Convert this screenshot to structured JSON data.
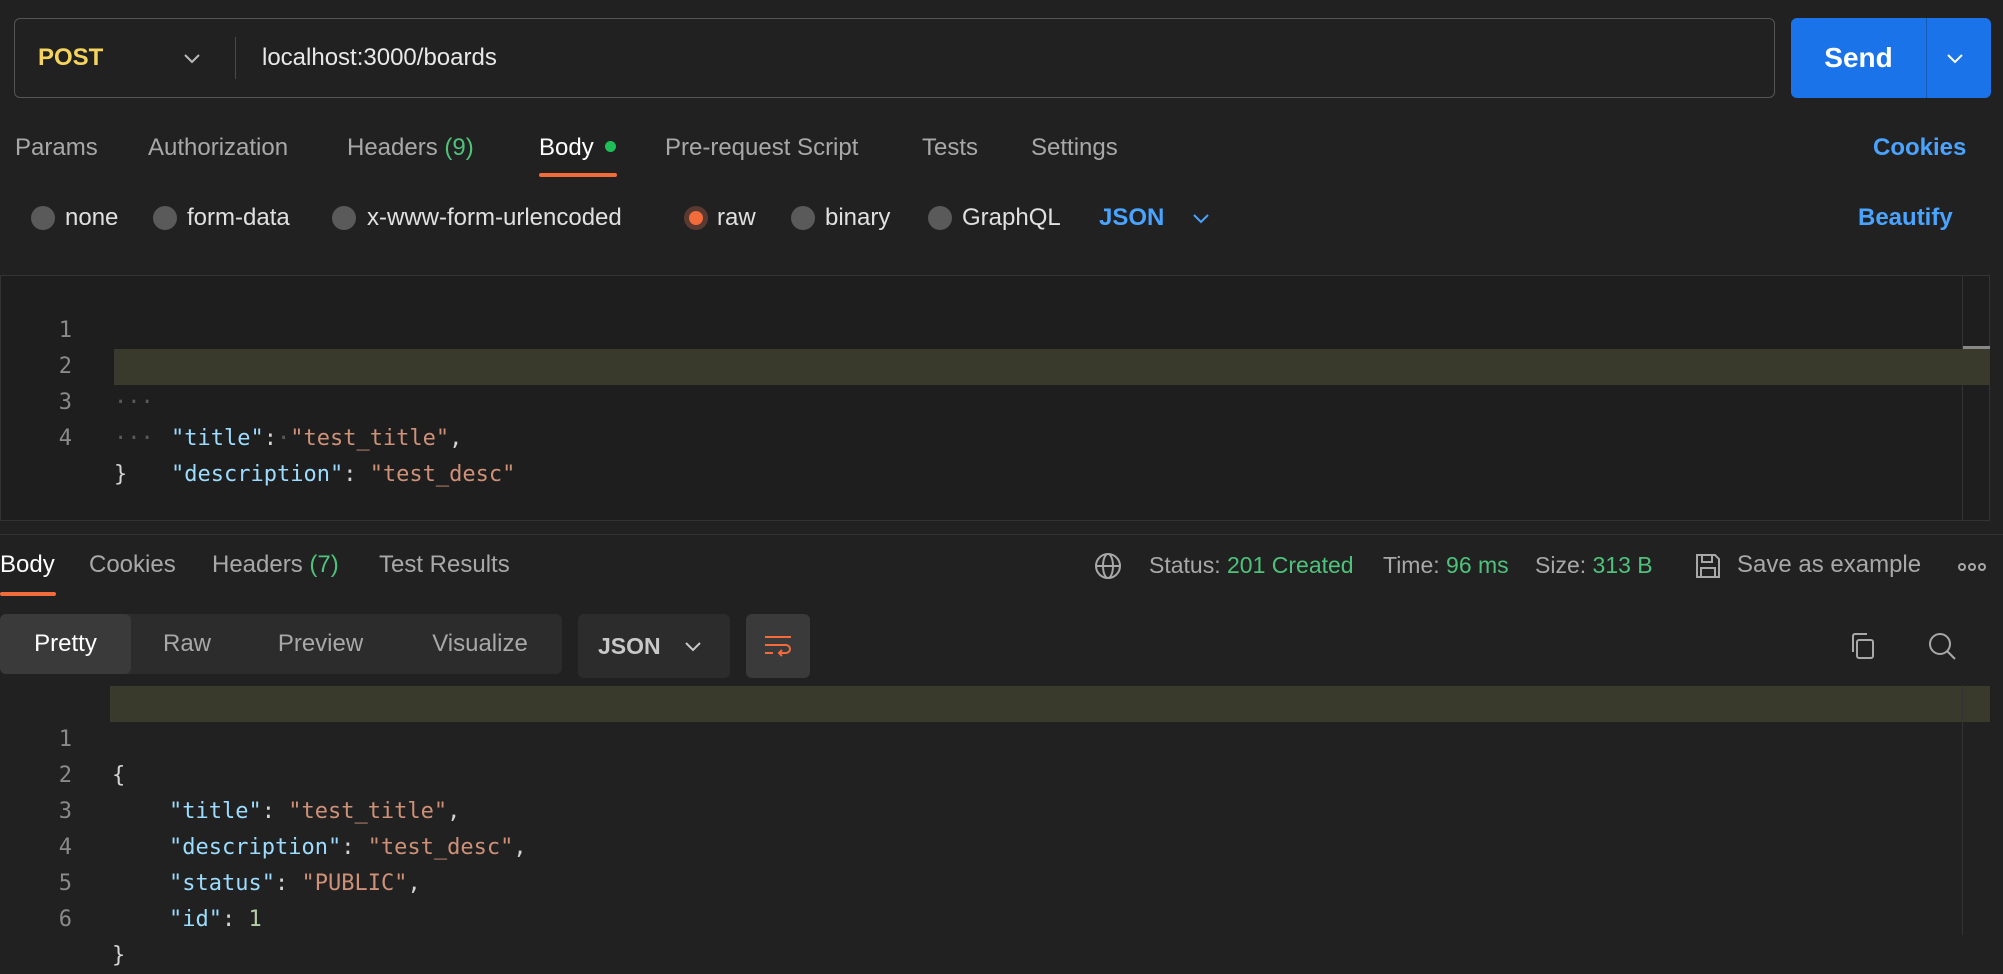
{
  "request": {
    "method": "POST",
    "url": "localhost:3000/boards",
    "send_label": "Send"
  },
  "request_tabs": [
    {
      "label": "Params"
    },
    {
      "label": "Authorization"
    },
    {
      "label": "Headers",
      "count": "(9)"
    },
    {
      "label": "Body",
      "active": true
    },
    {
      "label": "Pre-request Script"
    },
    {
      "label": "Tests"
    },
    {
      "label": "Settings"
    }
  ],
  "cookies_link": "Cookies",
  "body_types": [
    {
      "label": "none"
    },
    {
      "label": "form-data"
    },
    {
      "label": "x-www-form-urlencoded"
    },
    {
      "label": "raw",
      "selected": true
    },
    {
      "label": "binary"
    },
    {
      "label": "GraphQL"
    }
  ],
  "body_language": "JSON",
  "beautify_label": "Beautify",
  "request_body": {
    "line_numbers": [
      "1",
      "2",
      "3",
      "4"
    ],
    "open_brace": "{",
    "close_brace": "}",
    "fields": [
      {
        "key": "\"title\"",
        "value": "\"test_title\"",
        "trailing": ","
      },
      {
        "key": "\"description\"",
        "value": "\"test_desc\"",
        "trailing": ""
      }
    ]
  },
  "response_tabs": [
    {
      "label": "Body",
      "active": true
    },
    {
      "label": "Cookies"
    },
    {
      "label": "Headers",
      "count": "(7)"
    },
    {
      "label": "Test Results"
    }
  ],
  "response_meta": {
    "status_label": "Status:",
    "status_value": "201 Created",
    "time_label": "Time:",
    "time_value": "96 ms",
    "size_label": "Size:",
    "size_value": "313 B",
    "save_label": "Save as example"
  },
  "view_modes": [
    "Pretty",
    "Raw",
    "Preview",
    "Visualize"
  ],
  "response_format": "JSON",
  "response_body": {
    "line_numbers": [
      "1",
      "2",
      "3",
      "4",
      "5",
      "6"
    ],
    "open_brace": "{",
    "close_brace": "}",
    "fields": [
      {
        "key": "\"title\"",
        "value": "\"test_title\"",
        "trailing": ","
      },
      {
        "key": "\"description\"",
        "value": "\"test_desc\"",
        "trailing": ","
      },
      {
        "key": "\"status\"",
        "value": "\"PUBLIC\"",
        "trailing": ","
      },
      {
        "key": "\"id\"",
        "value": "1",
        "trailing": ""
      }
    ]
  },
  "colors": {
    "accent": "#f26b3a",
    "send": "#1a73e8",
    "success": "#4ec27a",
    "method": "#f4d35e"
  }
}
